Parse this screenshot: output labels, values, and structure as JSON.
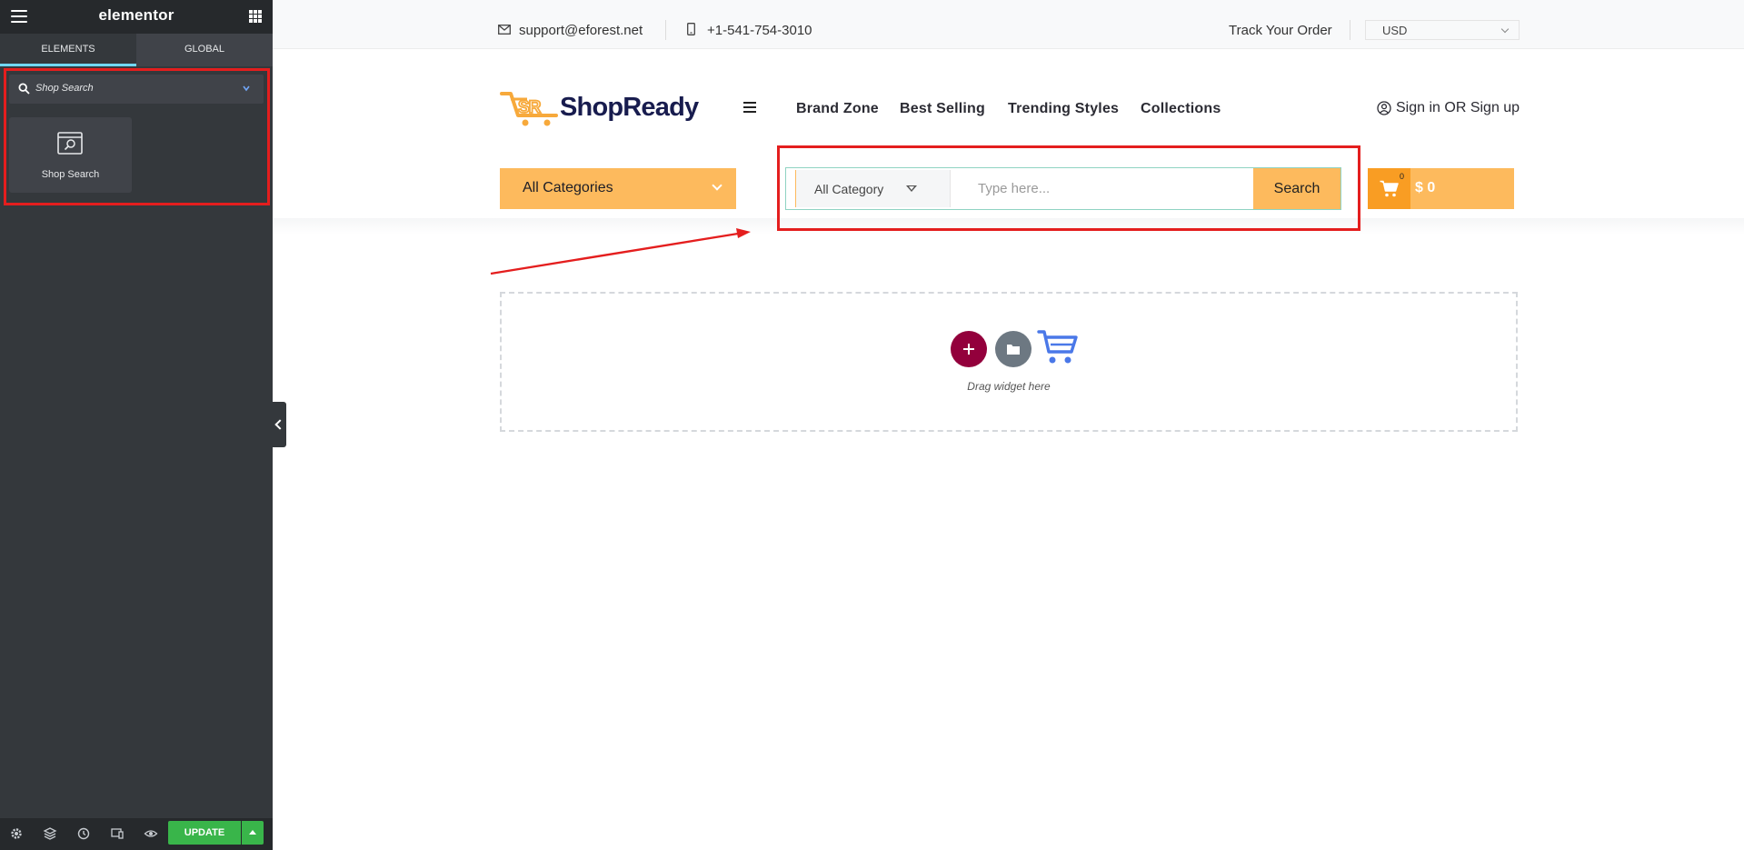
{
  "panel": {
    "title": "elementor",
    "tabs": [
      {
        "label": "ELEMENTS",
        "active": true
      },
      {
        "label": "GLOBAL",
        "active": false
      }
    ],
    "search": {
      "value": "Shop Search"
    },
    "widgets": [
      {
        "label": "Shop Search",
        "icon": "shop-search-widget-icon"
      }
    ],
    "footer": {
      "icons": [
        "settings-icon",
        "navigator-layers-icon",
        "history-icon",
        "responsive-mode-icon",
        "preview-eye-icon"
      ],
      "update_label": "UPDATE"
    }
  },
  "topbar": {
    "email": "support@eforest.net",
    "phone": "+1-541-754-3010",
    "track_order": "Track Your Order",
    "currency": "USD"
  },
  "header": {
    "logo_text": "ShopReady",
    "nav": [
      "Brand Zone",
      "Best Selling",
      "Trending Styles",
      "Collections"
    ],
    "signin": "Sign in OR Sign up"
  },
  "search_bar": {
    "categories_label": "All Categories",
    "search_category": "All Category",
    "input_placeholder": "Type here...",
    "button_label": "Search"
  },
  "cart": {
    "count": "0",
    "total": "$ 0"
  },
  "canvas": {
    "drop_label": "Drag widget here"
  },
  "colors": {
    "accent_orange": "#fdba5d",
    "cart_orange": "#f99d23",
    "highlight_red": "#e41e1e",
    "elementor_maroon": "#93003c",
    "update_green": "#39b54a",
    "panel_dark": "#34383c"
  }
}
